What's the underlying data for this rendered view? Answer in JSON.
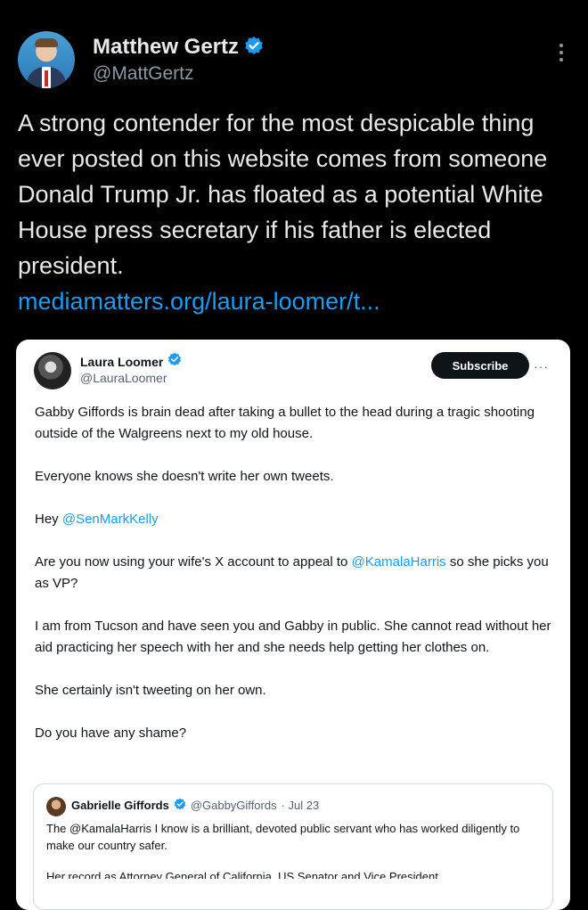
{
  "tweet": {
    "author": {
      "name": "Matthew Gertz",
      "handle": "@MattGertz"
    },
    "text": "A strong contender for the most despicable thing ever posted on this website comes from someone Donald Trump Jr. has floated as a potential White House press secretary if his father is elected president.",
    "link": "mediamatters.org/laura-loomer/t..."
  },
  "embedded": {
    "author": {
      "name": "Laura Loomer",
      "handle": "@LauraLoomer"
    },
    "subscribe_label": "Subscribe",
    "more_label": "···",
    "para1": "Gabby Giffords is brain dead after taking a bullet to the head during a tragic shooting outside of the Walgreens next to my old house.",
    "para2": "Everyone knows she doesn't write her own tweets.",
    "para3_prefix": "Hey ",
    "para3_mention": "@SenMarkKelly",
    "para4_prefix": "Are you now using your wife's X account to appeal to ",
    "para4_mention": "@KamalaHarris",
    "para4_suffix": " so she picks you as VP?",
    "para5": "I am from Tucson and have seen you and Gabby in public. She cannot read without her aid practicing her speech with her and she needs help getting her clothes on.",
    "para6": "She certainly isn't tweeting on her own.",
    "para7": "Do you have any shame?",
    "quote": {
      "name": "Gabrielle Giffords",
      "handle": "@GabbyGiffords",
      "date": "· Jul 23",
      "text": "The @KamalaHarris I know is a brilliant, devoted public servant who has worked diligently to make our country safer.",
      "more": "Her record as Attorney General of California, US Senator and Vice President"
    }
  },
  "colors": {
    "background": "#000000",
    "link": "#1d9bf0",
    "verified": "#1d9bf0"
  },
  "icons": [
    "verified-badge-icon",
    "more-vertical-icon",
    "more-horizontal-icon"
  ]
}
